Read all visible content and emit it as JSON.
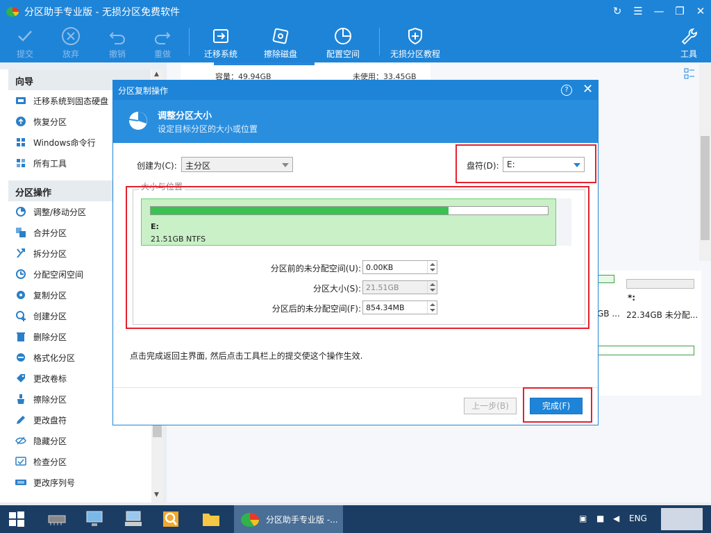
{
  "window": {
    "title": "分区助手专业版 - 无损分区免费软件"
  },
  "toolbar": {
    "items": [
      {
        "label": "提交",
        "icon": "check-icon",
        "enabled": false
      },
      {
        "label": "放弃",
        "icon": "cancel-icon",
        "enabled": false
      },
      {
        "label": "撤销",
        "icon": "undo-icon",
        "enabled": false
      },
      {
        "label": "重做",
        "icon": "redo-icon",
        "enabled": false
      },
      {
        "label": "迁移系统",
        "icon": "migrate-icon",
        "enabled": true
      },
      {
        "label": "擦除磁盘",
        "icon": "wipe-disk-icon",
        "enabled": true
      },
      {
        "label": "配置空间",
        "icon": "allocate-icon",
        "enabled": true
      },
      {
        "label": "无损分区教程",
        "icon": "shield-icon",
        "enabled": true
      },
      {
        "label": "工具",
        "icon": "wrench-icon",
        "enabled": true
      }
    ]
  },
  "sidebar": {
    "wizard_header": "向导",
    "wizard_items": [
      {
        "label": "迁移系统到固态硬盘",
        "icon": "migrate-ssd-icon"
      },
      {
        "label": "恢复分区",
        "icon": "recover-icon"
      },
      {
        "label": "Windows命令行",
        "icon": "windows-icon"
      },
      {
        "label": "所有工具",
        "icon": "tools-grid-icon"
      }
    ],
    "ops_header": "分区操作",
    "ops_items": [
      {
        "label": "调整/移动分区",
        "icon": "resize-icon"
      },
      {
        "label": "合并分区",
        "icon": "merge-icon"
      },
      {
        "label": "拆分分区",
        "icon": "split-icon"
      },
      {
        "label": "分配空闲空间",
        "icon": "allocate-free-icon"
      },
      {
        "label": "复制分区",
        "icon": "copy-icon"
      },
      {
        "label": "创建分区",
        "icon": "create-icon"
      },
      {
        "label": "删除分区",
        "icon": "delete-icon"
      },
      {
        "label": "格式化分区",
        "icon": "format-icon"
      },
      {
        "label": "更改卷标",
        "icon": "label-icon"
      },
      {
        "label": "擦除分区",
        "icon": "wipe-icon"
      },
      {
        "label": "更改盘符",
        "icon": "pencil-icon"
      },
      {
        "label": "隐藏分区",
        "icon": "eye-hide-icon"
      },
      {
        "label": "检查分区",
        "icon": "check-partition-icon"
      },
      {
        "label": "更改序列号",
        "icon": "serial-icon"
      }
    ]
  },
  "background": {
    "capacity": "容量：49.94GB",
    "unused": "未使用：33.45GB",
    "partition_size_left": "GB ...",
    "partition_star": "*:",
    "partition_size_right": "22.34GB 未分配..."
  },
  "dialog": {
    "title": "分区复制操作",
    "help": "?",
    "header_title": "调整分区大小",
    "header_subtitle": "设定目标分区的大小或位置",
    "create_as_label": "创建为(C):",
    "create_as_value": "主分区",
    "drive_letter_label": "盘符(D):",
    "drive_letter_value": "E:",
    "group_title": "大小与位置",
    "partition_name": "E:",
    "partition_detail": "21.51GB NTFS",
    "usage_fraction": 0.75,
    "fields": [
      {
        "label": "分区前的未分配空间(U):",
        "value": "0.00KB",
        "enabled": true
      },
      {
        "label": "分区大小(S):",
        "value": "21.51GB",
        "enabled": false
      },
      {
        "label": "分区后的未分配空间(F):",
        "value": "854.34MB",
        "enabled": true
      }
    ],
    "hint": "点击完成返回主界面, 然后点击工具栏上的提交使这个操作生效.",
    "prev_button": "上一步(B)",
    "done_button": "完成(F)"
  },
  "taskbar": {
    "active_app": "分区助手专业版 -...",
    "language": "ENG"
  },
  "colors": {
    "accent": "#1e84d8",
    "highlight": "#e3202b",
    "partition_fill": "#39c152"
  }
}
